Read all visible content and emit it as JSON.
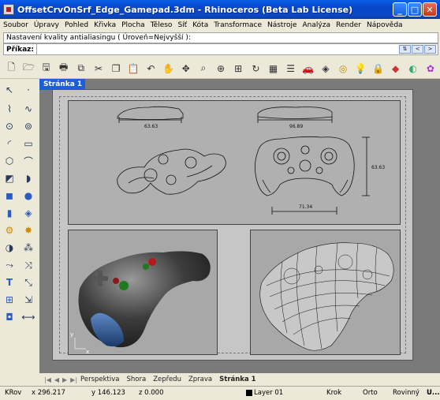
{
  "window": {
    "title": "OffsetCrvOnSrf_Edge_Gamepad.3dm - Rhinoceros (Beta Lab License)"
  },
  "menu": [
    "Soubor",
    "Úpravy",
    "Pohled",
    "Křivka",
    "Plocha",
    "Těleso",
    "Síť",
    "Kóta",
    "Transformace",
    "Nástroje",
    "Analýza",
    "Render",
    "Nápověda"
  ],
  "command": {
    "history": "Nastavení kvality antialiasingu ( Úroveň=Nejvyšší ):",
    "prompt_label": "Příkaz:",
    "value": ""
  },
  "page_tab": "Stránka 1",
  "drawing": {
    "dim_top_left": "63.63",
    "dim_top_right": "96.89",
    "dim_right_vertical": "63.63",
    "dim_bottom": "71.34",
    "axis_y": "y",
    "axis_x": "x"
  },
  "tabs": {
    "items": [
      "Perspektiva",
      "Shora",
      "Zepředu",
      "Zprava",
      "Stránka 1"
    ],
    "active": "Stránka 1"
  },
  "status": {
    "cplane": "KRov",
    "x": "x 296.217",
    "y": "y 146.123",
    "z": "z 0.000",
    "layer": "Layer 01",
    "snap": "Krok",
    "ortho": "Orto",
    "planar": "Rovinný",
    "osnap": "U..."
  },
  "icons": {
    "toolbar": [
      "new-icon",
      "open-icon",
      "save-icon",
      "print-icon",
      "import-icon",
      "cut-icon",
      "copy-icon",
      "paste-icon",
      "undo-icon",
      "pan-icon",
      "move-icon",
      "zoom-window-icon",
      "zoom-extents-icon",
      "zoom-selected-icon",
      "rotate-view-icon",
      "grid-icon",
      "layer-icon",
      "car-icon",
      "render-icon",
      "color-icon",
      "light-icon",
      "lock-icon",
      "material-icon",
      "environment-icon",
      "help-icon"
    ],
    "left": [
      "select-icon",
      "point-icon",
      "polyline-icon",
      "curve-icon",
      "circle-icon",
      "ellipse-icon",
      "arc-icon",
      "rectangle-icon",
      "polygon-icon",
      "freeform-icon",
      "surface-icon",
      "extrude-icon",
      "box-icon",
      "sphere-icon",
      "cylinder-icon",
      "mesh-icon",
      "gear-icon",
      "explode-icon",
      "boolean-icon",
      "fillet-icon",
      "trim-icon",
      "split-icon",
      "text-icon",
      "scale-icon",
      "group-icon",
      "align-icon",
      "object-icon",
      "dimension-icon"
    ]
  },
  "accent": "#1d5fd6"
}
